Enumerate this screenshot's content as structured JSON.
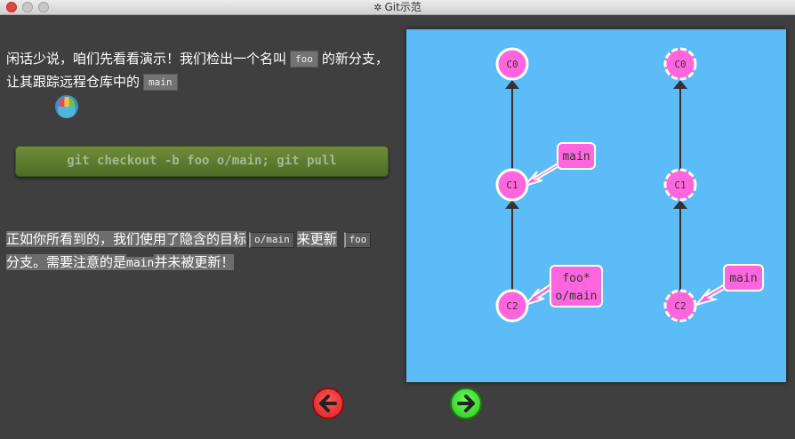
{
  "window": {
    "title": "Git示范"
  },
  "intro": {
    "text_before": "闲话少说，咱们先看看演示！我们检出一个名叫",
    "branch_foo": "foo",
    "text_middle": "的新分支，让其跟踪远程仓库中的",
    "branch_main": "main"
  },
  "command": {
    "label": "git checkout -b foo o/main; git pull"
  },
  "explanation": {
    "text_1": "正如你所看到的，我们使用了隐含的目标",
    "target": "o/main",
    "text_2": "来更新",
    "branch": "foo",
    "text_3": "分支。需要注意的是",
    "main_word": "main",
    "text_4": "并未被更新！"
  },
  "graph": {
    "local": {
      "commits": [
        "C0",
        "C1",
        "C2"
      ],
      "labels": [
        {
          "text": "main",
          "points_to": "C1"
        },
        {
          "text": "foo*",
          "points_to": "C2"
        },
        {
          "text": "o/main",
          "points_to": "C2"
        }
      ]
    },
    "remote": {
      "commits": [
        "C0",
        "C1",
        "C2"
      ],
      "labels": [
        {
          "text": "main",
          "points_to": "C2"
        }
      ]
    }
  },
  "nav": {
    "back_icon": "arrow-left-icon",
    "forward_icon": "arrow-right-icon"
  },
  "colors": {
    "commit": "#ff66dd",
    "canvas": "#5cbcf8",
    "back": "#e02a2a",
    "forward": "#3adf28"
  }
}
